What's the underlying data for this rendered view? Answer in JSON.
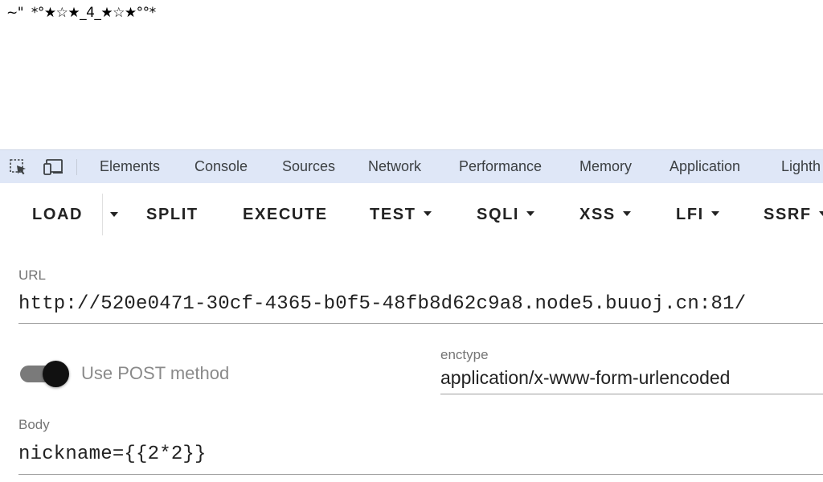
{
  "page_output": "~\"  *°★☆★_4_★☆★°°*",
  "devtools": {
    "icons": [
      "inspect-element-icon",
      "device-toolbar-icon"
    ],
    "tabs": [
      "Elements",
      "Console",
      "Sources",
      "Network",
      "Performance",
      "Memory",
      "Application",
      "Lighth"
    ]
  },
  "toolbar": {
    "load": "LOAD",
    "split": "SPLIT",
    "execute": "EXECUTE",
    "test": "TEST",
    "sqli": "SQLI",
    "xss": "XSS",
    "lfi": "LFI",
    "ssrf": "SSRF"
  },
  "url": {
    "label": "URL",
    "value": "http://520e0471-30cf-4365-b0f5-48fb8d62c9a8.node5.buuoj.cn:81/"
  },
  "post": {
    "label": "Use POST method",
    "enabled": true
  },
  "enctype": {
    "label": "enctype",
    "value": "application/x-www-form-urlencoded"
  },
  "body": {
    "label": "Body",
    "value": "nickname={{2*2}}"
  },
  "colors": {
    "devtools_bar": "#dfe7f7",
    "toggle_thumb": "#111111",
    "toggle_track": "#7a7a7a"
  }
}
